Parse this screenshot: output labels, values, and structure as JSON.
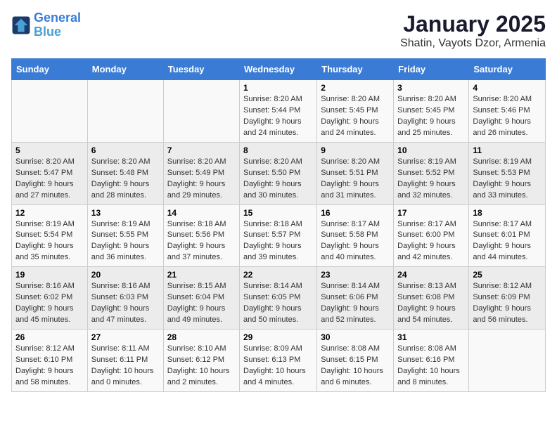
{
  "logo": {
    "line1": "General",
    "line2": "Blue"
  },
  "title": "January 2025",
  "subtitle": "Shatin, Vayots Dzor, Armenia",
  "days_of_week": [
    "Sunday",
    "Monday",
    "Tuesday",
    "Wednesday",
    "Thursday",
    "Friday",
    "Saturday"
  ],
  "weeks": [
    [
      {
        "day": "",
        "detail": ""
      },
      {
        "day": "",
        "detail": ""
      },
      {
        "day": "",
        "detail": ""
      },
      {
        "day": "1",
        "detail": "Sunrise: 8:20 AM\nSunset: 5:44 PM\nDaylight: 9 hours\nand 24 minutes."
      },
      {
        "day": "2",
        "detail": "Sunrise: 8:20 AM\nSunset: 5:45 PM\nDaylight: 9 hours\nand 24 minutes."
      },
      {
        "day": "3",
        "detail": "Sunrise: 8:20 AM\nSunset: 5:45 PM\nDaylight: 9 hours\nand 25 minutes."
      },
      {
        "day": "4",
        "detail": "Sunrise: 8:20 AM\nSunset: 5:46 PM\nDaylight: 9 hours\nand 26 minutes."
      }
    ],
    [
      {
        "day": "5",
        "detail": "Sunrise: 8:20 AM\nSunset: 5:47 PM\nDaylight: 9 hours\nand 27 minutes."
      },
      {
        "day": "6",
        "detail": "Sunrise: 8:20 AM\nSunset: 5:48 PM\nDaylight: 9 hours\nand 28 minutes."
      },
      {
        "day": "7",
        "detail": "Sunrise: 8:20 AM\nSunset: 5:49 PM\nDaylight: 9 hours\nand 29 minutes."
      },
      {
        "day": "8",
        "detail": "Sunrise: 8:20 AM\nSunset: 5:50 PM\nDaylight: 9 hours\nand 30 minutes."
      },
      {
        "day": "9",
        "detail": "Sunrise: 8:20 AM\nSunset: 5:51 PM\nDaylight: 9 hours\nand 31 minutes."
      },
      {
        "day": "10",
        "detail": "Sunrise: 8:19 AM\nSunset: 5:52 PM\nDaylight: 9 hours\nand 32 minutes."
      },
      {
        "day": "11",
        "detail": "Sunrise: 8:19 AM\nSunset: 5:53 PM\nDaylight: 9 hours\nand 33 minutes."
      }
    ],
    [
      {
        "day": "12",
        "detail": "Sunrise: 8:19 AM\nSunset: 5:54 PM\nDaylight: 9 hours\nand 35 minutes."
      },
      {
        "day": "13",
        "detail": "Sunrise: 8:19 AM\nSunset: 5:55 PM\nDaylight: 9 hours\nand 36 minutes."
      },
      {
        "day": "14",
        "detail": "Sunrise: 8:18 AM\nSunset: 5:56 PM\nDaylight: 9 hours\nand 37 minutes."
      },
      {
        "day": "15",
        "detail": "Sunrise: 8:18 AM\nSunset: 5:57 PM\nDaylight: 9 hours\nand 39 minutes."
      },
      {
        "day": "16",
        "detail": "Sunrise: 8:17 AM\nSunset: 5:58 PM\nDaylight: 9 hours\nand 40 minutes."
      },
      {
        "day": "17",
        "detail": "Sunrise: 8:17 AM\nSunset: 6:00 PM\nDaylight: 9 hours\nand 42 minutes."
      },
      {
        "day": "18",
        "detail": "Sunrise: 8:17 AM\nSunset: 6:01 PM\nDaylight: 9 hours\nand 44 minutes."
      }
    ],
    [
      {
        "day": "19",
        "detail": "Sunrise: 8:16 AM\nSunset: 6:02 PM\nDaylight: 9 hours\nand 45 minutes."
      },
      {
        "day": "20",
        "detail": "Sunrise: 8:16 AM\nSunset: 6:03 PM\nDaylight: 9 hours\nand 47 minutes."
      },
      {
        "day": "21",
        "detail": "Sunrise: 8:15 AM\nSunset: 6:04 PM\nDaylight: 9 hours\nand 49 minutes."
      },
      {
        "day": "22",
        "detail": "Sunrise: 8:14 AM\nSunset: 6:05 PM\nDaylight: 9 hours\nand 50 minutes."
      },
      {
        "day": "23",
        "detail": "Sunrise: 8:14 AM\nSunset: 6:06 PM\nDaylight: 9 hours\nand 52 minutes."
      },
      {
        "day": "24",
        "detail": "Sunrise: 8:13 AM\nSunset: 6:08 PM\nDaylight: 9 hours\nand 54 minutes."
      },
      {
        "day": "25",
        "detail": "Sunrise: 8:12 AM\nSunset: 6:09 PM\nDaylight: 9 hours\nand 56 minutes."
      }
    ],
    [
      {
        "day": "26",
        "detail": "Sunrise: 8:12 AM\nSunset: 6:10 PM\nDaylight: 9 hours\nand 58 minutes."
      },
      {
        "day": "27",
        "detail": "Sunrise: 8:11 AM\nSunset: 6:11 PM\nDaylight: 10 hours\nand 0 minutes."
      },
      {
        "day": "28",
        "detail": "Sunrise: 8:10 AM\nSunset: 6:12 PM\nDaylight: 10 hours\nand 2 minutes."
      },
      {
        "day": "29",
        "detail": "Sunrise: 8:09 AM\nSunset: 6:13 PM\nDaylight: 10 hours\nand 4 minutes."
      },
      {
        "day": "30",
        "detail": "Sunrise: 8:08 AM\nSunset: 6:15 PM\nDaylight: 10 hours\nand 6 minutes."
      },
      {
        "day": "31",
        "detail": "Sunrise: 8:08 AM\nSunset: 6:16 PM\nDaylight: 10 hours\nand 8 minutes."
      },
      {
        "day": "",
        "detail": ""
      }
    ]
  ]
}
